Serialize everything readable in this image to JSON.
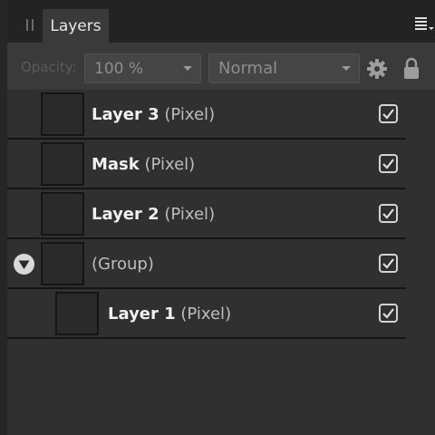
{
  "panel": {
    "tab_label": "Layers"
  },
  "toolbar": {
    "opacity_label": "Opacity:",
    "opacity_value": "100 %",
    "blend_mode": "Normal"
  },
  "layers": [
    {
      "name": "Layer 3",
      "type": "(Pixel)",
      "visible": true
    },
    {
      "name": "Mask",
      "type": "(Pixel)",
      "visible": true
    },
    {
      "name": "Layer 2",
      "type": "(Pixel)",
      "visible": true
    },
    {
      "name": "(Group)",
      "type": "",
      "visible": true,
      "expanded": true
    },
    {
      "name": "Layer 1",
      "type": "(Pixel)",
      "visible": true,
      "child_of_group": true
    }
  ],
  "colors": {
    "panel_bg": "#303030",
    "toolbar_bg": "#3a3a3a",
    "divider": "#151515"
  }
}
